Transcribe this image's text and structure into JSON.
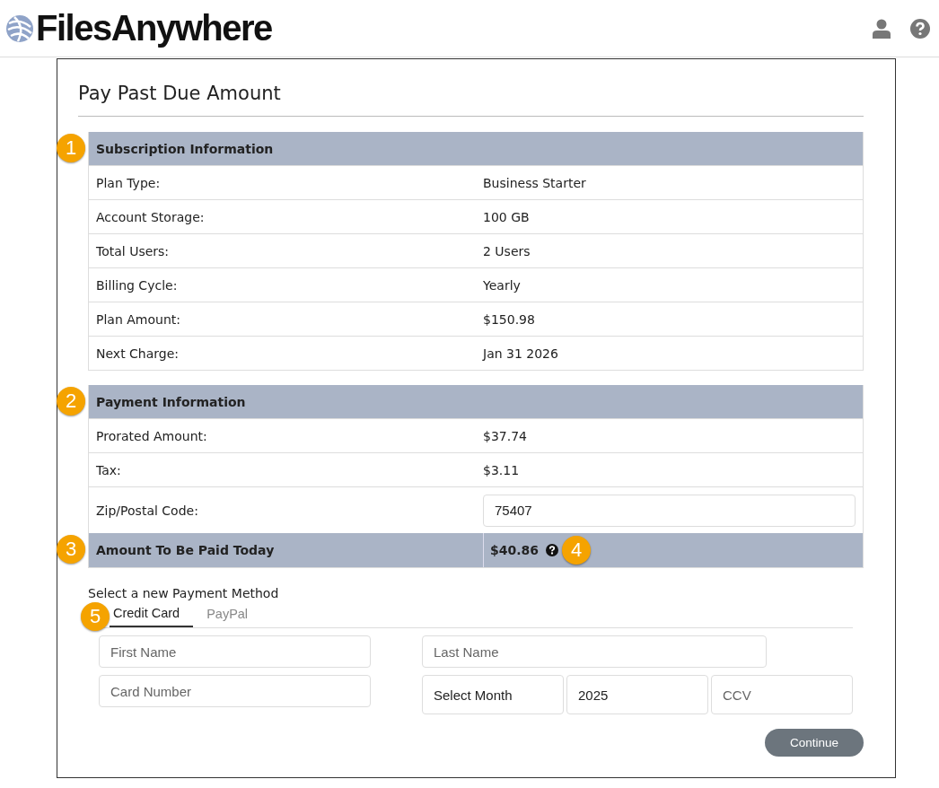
{
  "header": {
    "logo": "FilesAnywhere"
  },
  "title": "Pay Past Due Amount",
  "subscription": {
    "callout": "1",
    "heading": "Subscription Information",
    "rows": [
      {
        "label": "Plan Type:",
        "value": "Business Starter"
      },
      {
        "label": "Account Storage:",
        "value": "100 GB"
      },
      {
        "label": "Total Users:",
        "value": "2 Users"
      },
      {
        "label": "Billing Cycle:",
        "value": "Yearly"
      },
      {
        "label": "Plan Amount:",
        "value": "$150.98"
      },
      {
        "label": "Next Charge:",
        "value": "Jan 31 2026"
      }
    ]
  },
  "payment": {
    "callout": "2",
    "heading": "Payment Information",
    "rows": [
      {
        "label": "Prorated Amount:",
        "value": "$37.74"
      },
      {
        "label": "Tax:",
        "value": "$3.11"
      }
    ],
    "zip": {
      "label": "Zip/Postal Code:",
      "value": "75407"
    },
    "total": {
      "callout": "3",
      "label": "Amount To Be Paid Today",
      "value": "$40.86",
      "help_callout": "4"
    }
  },
  "method": {
    "label": "Select a new Payment Method",
    "tab_callout": "5",
    "tabs": [
      {
        "label": "Credit Card",
        "selected": true
      },
      {
        "label": "PayPal",
        "selected": false
      }
    ],
    "first_name": {
      "placeholder": "First Name"
    },
    "last_name": {
      "placeholder": "Last Name"
    },
    "card_number": {
      "placeholder": "Card Number"
    },
    "month": {
      "value": "Select Month"
    },
    "year": {
      "value": "2025"
    },
    "ccv": {
      "placeholder": "CCV"
    }
  },
  "continue_button": "Continue"
}
